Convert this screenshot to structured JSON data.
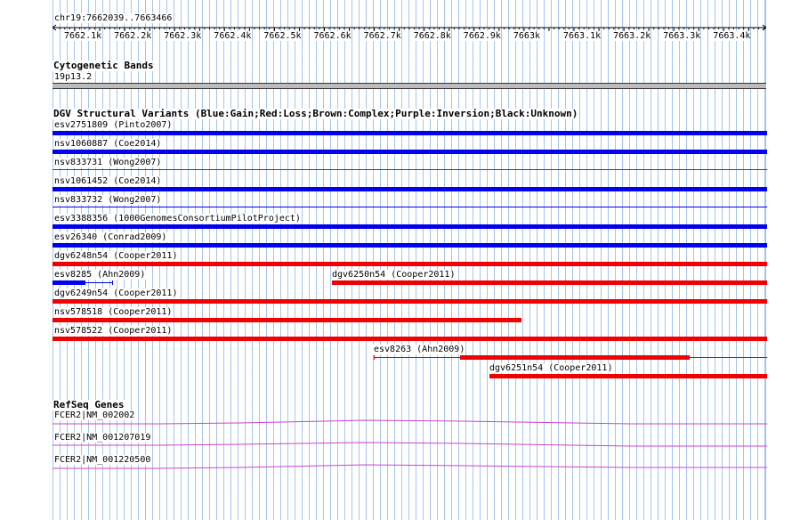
{
  "coordinate_label": "chr19:7662039..7663466",
  "ruler": {
    "ticks": [
      "7662.1k",
      "7662.2k",
      "7662.3k",
      "7662.4k",
      "7662.5k",
      "7662.6k",
      "7662.7k",
      "7662.8k",
      "7662.9k",
      "7663k",
      "7663.1k",
      "7663.2k",
      "7663.3k",
      "7663.4k"
    ]
  },
  "cytoband": {
    "title": "Cytogenetic Bands",
    "band": "19p13.2"
  },
  "dgv": {
    "title": "DGV Structural Variants (Blue:Gain;Red:Loss;Brown:Complex;Purple:Inversion;Black:Unknown)",
    "colors": {
      "gain": "#0000ee",
      "loss": "#ee0000"
    },
    "features": [
      {
        "label": "esv2751809 (Pinto2007)",
        "type": "gain"
      },
      {
        "label": "nsv1060887 (Coe2014)",
        "type": "gain"
      },
      {
        "label": "nsv833731 (Wong2007)",
        "type": "loss"
      },
      {
        "label": "nsv1061452 (Coe2014)",
        "type": "gain"
      },
      {
        "label": "nsv833732 (Wong2007)",
        "type": "gain"
      },
      {
        "label": "esv3388356 (1000GenomesConsortiumPilotProject)",
        "type": "gain"
      },
      {
        "label": "esv26340 (Conrad2009)",
        "type": "gain"
      },
      {
        "label": "dgv6248n54 (Cooper2011)",
        "type": "loss"
      },
      {
        "label": "esv8285 (Ahn2009)",
        "type": "gain"
      },
      {
        "label": "dgv6250n54 (Cooper2011)",
        "type": "loss"
      },
      {
        "label": "dgv6249n54 (Cooper2011)",
        "type": "loss"
      },
      {
        "label": "nsv578518 (Cooper2011)",
        "type": "loss"
      },
      {
        "label": "nsv578522 (Cooper2011)",
        "type": "loss"
      },
      {
        "label": "esv8263 (Ahn2009)",
        "type": "loss"
      },
      {
        "label": "dgv6251n54 (Cooper2011)",
        "type": "loss"
      }
    ]
  },
  "refseq": {
    "title": "RefSeq Genes",
    "color": "#cc44cc",
    "genes": [
      {
        "label": "FCER2|NM_002002"
      },
      {
        "label": "FCER2|NM_001207019"
      },
      {
        "label": "FCER2|NM_001220500"
      }
    ]
  }
}
